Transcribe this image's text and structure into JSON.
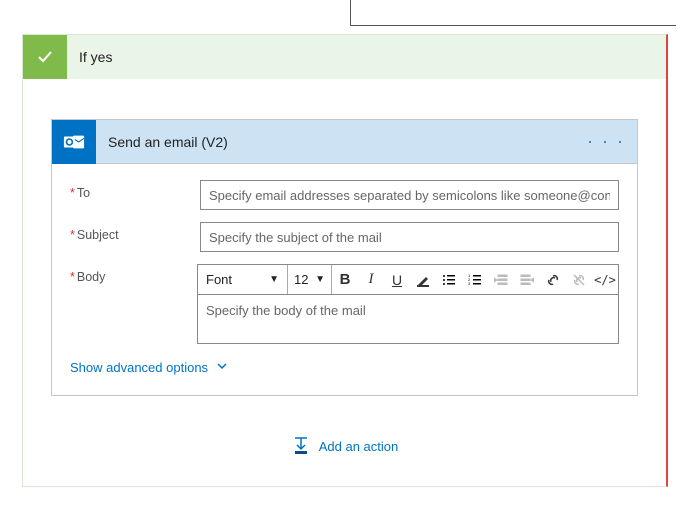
{
  "condition": {
    "title": "If yes"
  },
  "action": {
    "title": "Send an email (V2)",
    "fields": {
      "to": {
        "label": "To",
        "placeholder": "Specify email addresses separated by semicolons like someone@con"
      },
      "subject": {
        "label": "Subject",
        "placeholder": "Specify the subject of the mail"
      },
      "body": {
        "label": "Body",
        "placeholder": "Specify the body of the mail"
      }
    },
    "rte": {
      "font_label": "Font",
      "size_label": "12"
    },
    "advanced_options_label": "Show advanced options"
  },
  "add_action_label": "Add an action"
}
